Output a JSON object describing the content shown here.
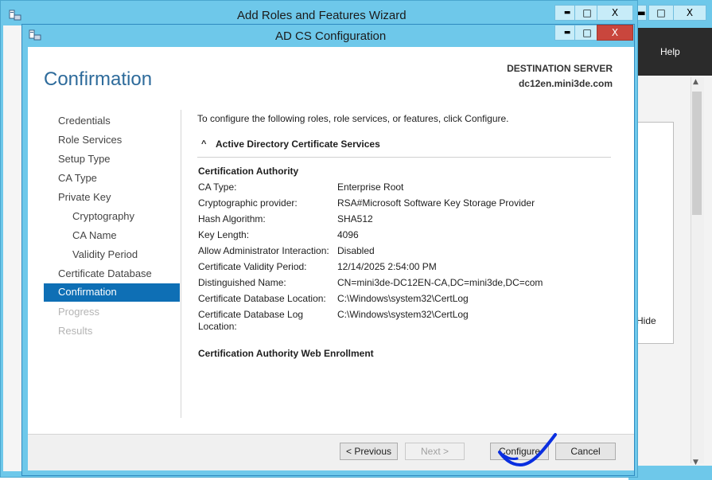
{
  "background_window": {
    "menu": {
      "help_label": "Help"
    },
    "hide_label": "Hide"
  },
  "wizard": {
    "title": "Add Roles and Features Wizard",
    "controls": {
      "minimize": "▬",
      "maximize": "□",
      "close": "X"
    }
  },
  "dialog": {
    "title": "AD CS Configuration",
    "controls": {
      "minimize": "▬",
      "maximize": "□",
      "close": "X"
    },
    "heading": "Confirmation",
    "destination": {
      "label": "DESTINATION SERVER",
      "value": "dc12en.mini3de.com"
    }
  },
  "nav": {
    "items": [
      {
        "label": "Credentials",
        "state": "normal"
      },
      {
        "label": "Role Services",
        "state": "normal"
      },
      {
        "label": "Setup Type",
        "state": "normal"
      },
      {
        "label": "CA Type",
        "state": "normal"
      },
      {
        "label": "Private Key",
        "state": "normal"
      },
      {
        "label": "Cryptography",
        "state": "sub"
      },
      {
        "label": "CA Name",
        "state": "sub"
      },
      {
        "label": "Validity Period",
        "state": "sub"
      },
      {
        "label": "Certificate Database",
        "state": "normal"
      },
      {
        "label": "Confirmation",
        "state": "active"
      },
      {
        "label": "Progress",
        "state": "disabled"
      },
      {
        "label": "Results",
        "state": "disabled"
      }
    ]
  },
  "content": {
    "intro": "To configure the following roles, role services, or features, click Configure.",
    "section_title": "Active Directory Certificate Services",
    "group1_title": "Certification Authority",
    "rows": [
      {
        "label": "CA Type:",
        "value": "Enterprise Root"
      },
      {
        "label": "Cryptographic provider:",
        "value": "RSA#Microsoft Software Key Storage Provider"
      },
      {
        "label": "Hash Algorithm:",
        "value": "SHA512"
      },
      {
        "label": "Key Length:",
        "value": "4096"
      },
      {
        "label": "Allow Administrator Interaction:",
        "value": "Disabled"
      },
      {
        "label": "Certificate Validity Period:",
        "value": "12/14/2025 2:54:00 PM"
      },
      {
        "label": "Distinguished Name:",
        "value": "CN=mini3de-DC12EN-CA,DC=mini3de,DC=com"
      },
      {
        "label": "Certificate Database Location:",
        "value": "C:\\Windows\\system32\\CertLog"
      },
      {
        "label": "Certificate Database Log Location:",
        "label_line1": "Certificate Database Log",
        "label_line2": "Location:",
        "value": "C:\\Windows\\system32\\CertLog"
      }
    ],
    "group2_title": "Certification Authority Web Enrollment"
  },
  "footer": {
    "previous_label": "< Previous",
    "next_label": "Next >",
    "configure_label": "Configure",
    "cancel_label": "Cancel"
  },
  "colors": {
    "title_bar": "#6ec8ea",
    "accent": "#0e6fb5",
    "heading": "#2e6b9b",
    "annotation": "#0a2ee0",
    "close_button": "#c9463d"
  }
}
